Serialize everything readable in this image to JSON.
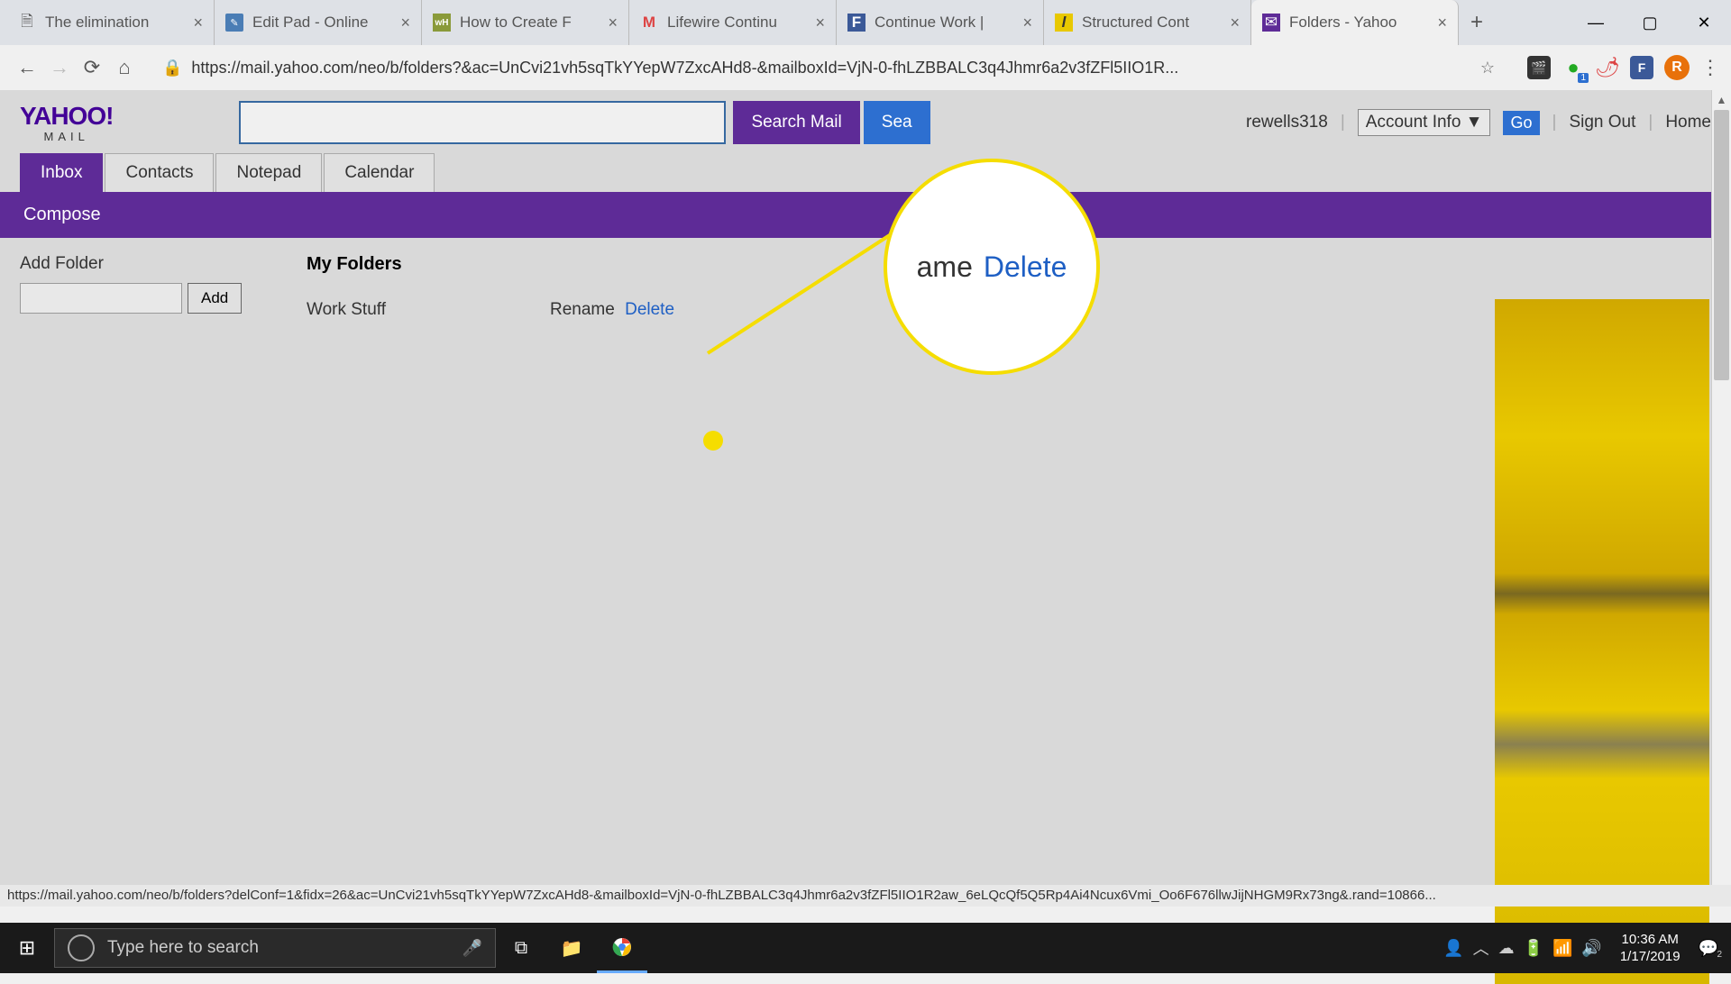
{
  "browser": {
    "tabs": [
      {
        "title": "The elimination",
        "icon": "file"
      },
      {
        "title": "Edit Pad - Online",
        "icon": "editpad"
      },
      {
        "title": "How to Create F",
        "icon": "wh"
      },
      {
        "title": "Lifewire Continu",
        "icon": "gmail"
      },
      {
        "title": "Continue Work |",
        "icon": "f"
      },
      {
        "title": "Structured Cont",
        "icon": "l"
      },
      {
        "title": "Folders - Yahoo",
        "icon": "yahoo",
        "active": true
      }
    ],
    "url": "https://mail.yahoo.com/neo/b/folders?&ac=UnCvi21vh5sqTkYYepW7ZxcAHd8-&mailboxId=VjN-0-fhLZBBALC3q4Jhmr6a2v3fZFl5IIO1R...",
    "profile_letter": "R",
    "ext_badge": "1"
  },
  "yahoo": {
    "logo_main": "YAHOO!",
    "logo_sub": "MAIL",
    "search_mail": "Search Mail",
    "search_web": "Sea",
    "user": "rewells318",
    "account_info": "Account Info  ▼",
    "go": "Go",
    "sign_out": "Sign Out",
    "home": "Home",
    "nav": {
      "inbox": "Inbox",
      "contacts": "Contacts",
      "notepad": "Notepad",
      "calendar": "Calendar"
    },
    "compose": "Compose",
    "add_folder_label": "Add Folder",
    "add_btn": "Add",
    "my_folders": "My Folders",
    "folders": [
      {
        "name": "Work Stuff",
        "rename": "Rename",
        "delete": "Delete"
      }
    ]
  },
  "callout": {
    "ame": "ame",
    "delete": "Delete"
  },
  "status_url": "https://mail.yahoo.com/neo/b/folders?delConf=1&fidx=26&ac=UnCvi21vh5sqTkYYepW7ZxcAHd8-&mailboxId=VjN-0-fhLZBBALC3q4Jhmr6a2v3fZFl5IIO1R2aw_6eLQcQf5Q5Rp4Ai4Ncux6Vmi_Oo6F676llwJijNHGM9Rx73ng&.rand=10866...",
  "taskbar": {
    "search_placeholder": "Type here to search",
    "time": "10:36 AM",
    "date": "1/17/2019",
    "badge": "2"
  }
}
